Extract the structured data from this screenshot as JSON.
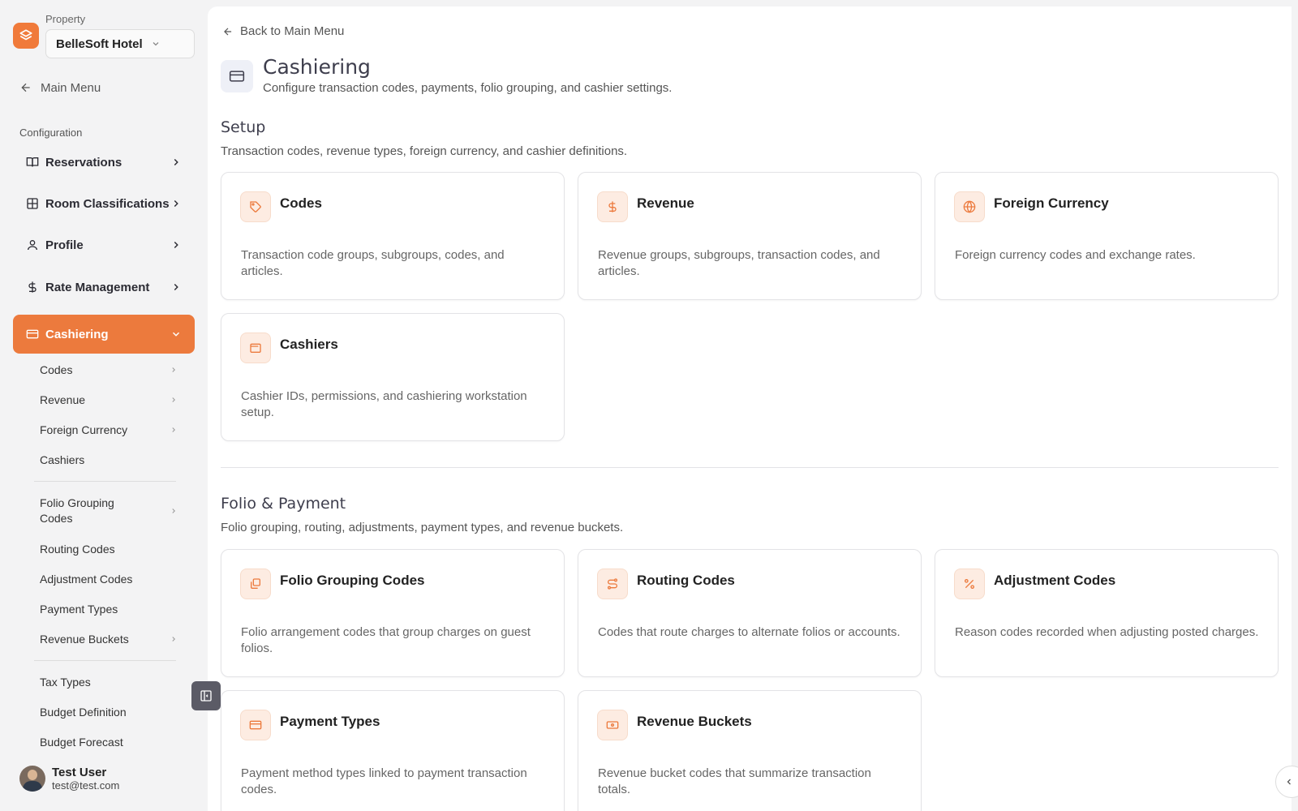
{
  "sidebar": {
    "property_label": "Property",
    "property_value": "BelleSoft Hotel",
    "main_menu": "Main Menu",
    "section_label": "Configuration",
    "nav": [
      {
        "label": "Reservations",
        "icon": "book-icon"
      },
      {
        "label": "Room Classifications",
        "icon": "grid-icon"
      },
      {
        "label": "Profile",
        "icon": "user-icon"
      },
      {
        "label": "Rate Management",
        "icon": "dollar-icon"
      },
      {
        "label": "Cashiering",
        "icon": "card-icon",
        "active": true
      }
    ],
    "sub": [
      {
        "label": "Codes"
      },
      {
        "label": "Revenue"
      },
      {
        "label": "Foreign Currency"
      },
      {
        "label": "Cashiers"
      },
      {
        "label": "Folio Grouping Codes"
      },
      {
        "label": "Routing Codes"
      },
      {
        "label": "Adjustment Codes"
      },
      {
        "label": "Payment Types"
      },
      {
        "label": "Revenue Buckets"
      },
      {
        "label": "Tax Types"
      },
      {
        "label": "Budget Definition"
      },
      {
        "label": "Budget Forecast"
      }
    ],
    "user": {
      "name": "Test User",
      "email": "test@test.com"
    }
  },
  "main": {
    "back": "Back to Main Menu",
    "title": "Cashiering",
    "subtitle": "Configure transaction codes, payments, folio grouping, and cashier settings.",
    "sections": [
      {
        "title": "Setup",
        "subtitle": "Transaction codes, revenue types, foreign currency, and cashier definitions.",
        "cards": [
          {
            "title": "Codes",
            "desc": "Transaction code groups, subgroups, codes, and articles.",
            "icon": "tag-icon"
          },
          {
            "title": "Revenue",
            "desc": "Revenue groups, subgroups, transaction codes, and articles.",
            "icon": "dollar-icon"
          },
          {
            "title": "Foreign Currency",
            "desc": "Foreign currency codes and exchange rates.",
            "icon": "globe-icon"
          },
          {
            "title": "Cashiers",
            "desc": "Cashier IDs, permissions, and cashiering workstation setup.",
            "icon": "wallet-icon"
          }
        ]
      },
      {
        "title": "Folio & Payment",
        "subtitle": "Folio grouping, routing, adjustments, payment types, and revenue buckets.",
        "cards": [
          {
            "title": "Folio Grouping Codes",
            "desc": "Folio arrangement codes that group charges on guest folios.",
            "icon": "layers-icon"
          },
          {
            "title": "Routing Codes",
            "desc": "Codes that route charges to alternate folios or accounts.",
            "icon": "route-icon"
          },
          {
            "title": "Adjustment Codes",
            "desc": "Reason codes recorded when adjusting posted charges.",
            "icon": "percent-icon"
          },
          {
            "title": "Payment Types",
            "desc": "Payment method types linked to payment transaction codes.",
            "icon": "card-icon"
          },
          {
            "title": "Revenue Buckets",
            "desc": "Revenue bucket codes that summarize transaction totals.",
            "icon": "banknote-icon"
          }
        ]
      }
    ]
  },
  "colors": {
    "accent": "#ec7a3d",
    "icon_bg": "#fdece2"
  }
}
